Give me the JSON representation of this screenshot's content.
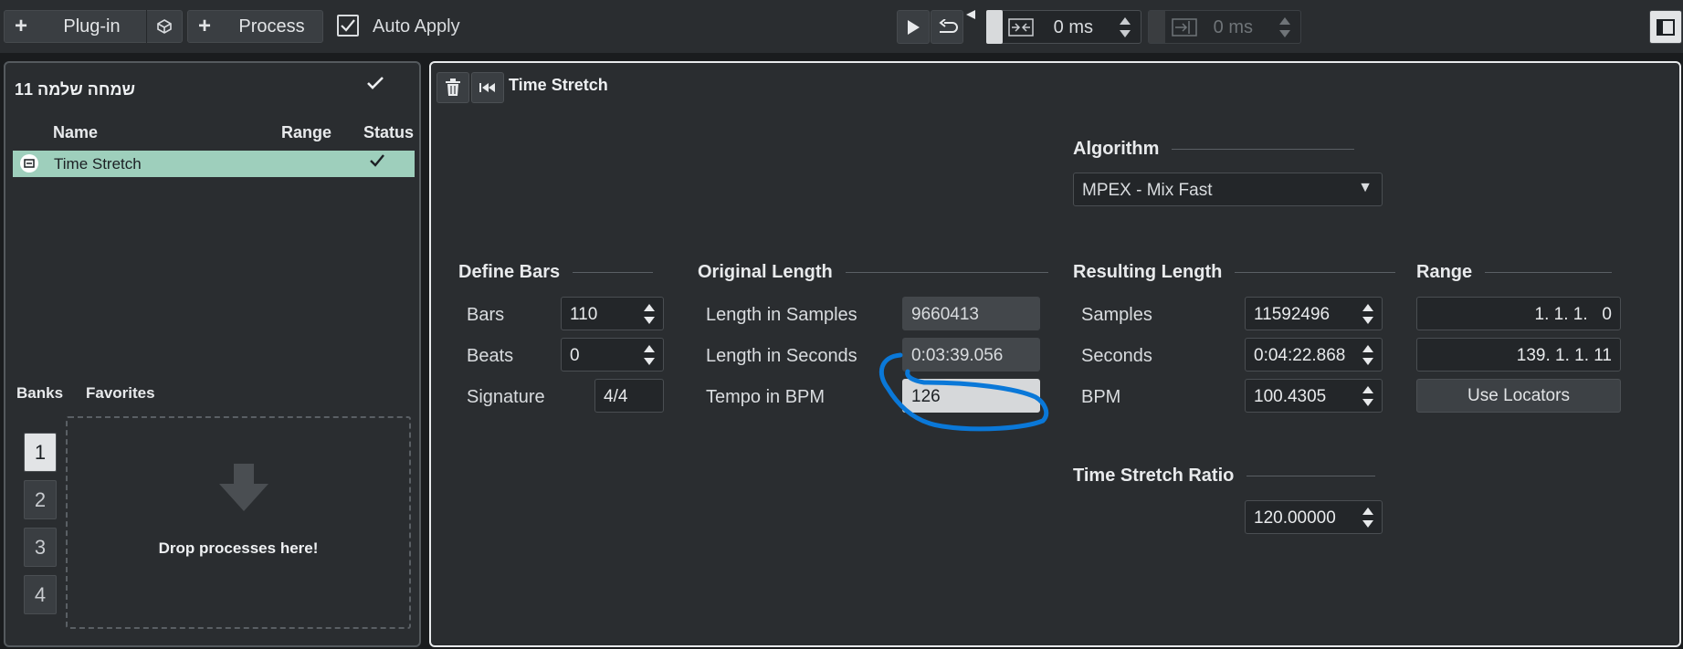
{
  "toolbar": {
    "plugin_label": "Plug-in",
    "process_label": "Process",
    "auto_apply_label": "Auto Apply",
    "auto_apply_checked": true,
    "fade_in_value": "0 ms",
    "fade_out_value": "0 ms"
  },
  "chain": {
    "title": "שמחה שלמה 11",
    "columns": {
      "name": "Name",
      "range": "Range",
      "status": "Status"
    },
    "rows": [
      {
        "name": "Time Stretch"
      }
    ]
  },
  "banks": {
    "tabs": {
      "banks": "Banks",
      "favorites": "Favorites"
    },
    "numbers": [
      "1",
      "2",
      "3",
      "4"
    ],
    "drop_text": "Drop processes here!"
  },
  "process": {
    "title": "Time Stretch",
    "algorithm": {
      "heading": "Algorithm",
      "value": "MPEX - Mix Fast"
    },
    "define_bars": {
      "heading": "Define Bars",
      "bars_label": "Bars",
      "bars_value": "110",
      "beats_label": "Beats",
      "beats_value": "0",
      "signature_label": "Signature",
      "signature_value": "4/4"
    },
    "original_length": {
      "heading": "Original Length",
      "samples_label": "Length in Samples",
      "samples_value": "9660413",
      "seconds_label": "Length in Seconds",
      "seconds_value": "0:03:39.056",
      "tempo_label": "Tempo in BPM",
      "tempo_value": "126"
    },
    "resulting_length": {
      "heading": "Resulting Length",
      "samples_label": "Samples",
      "samples_value": "11592496",
      "seconds_label": "Seconds",
      "seconds_value": "0:04:22.868",
      "bpm_label": "BPM",
      "bpm_value": "100.4305"
    },
    "range": {
      "heading": "Range",
      "start_value": "1. 1. 1.   0",
      "end_value": "139. 1. 1. 11",
      "use_locators_label": "Use Locators"
    },
    "ratio": {
      "heading": "Time Stretch Ratio",
      "value": "120.00000"
    }
  },
  "colors": {
    "selected_row": "#9ecfbc",
    "highlight_annotation": "#0a78d8",
    "panel_border_active": "#e8eaec"
  }
}
